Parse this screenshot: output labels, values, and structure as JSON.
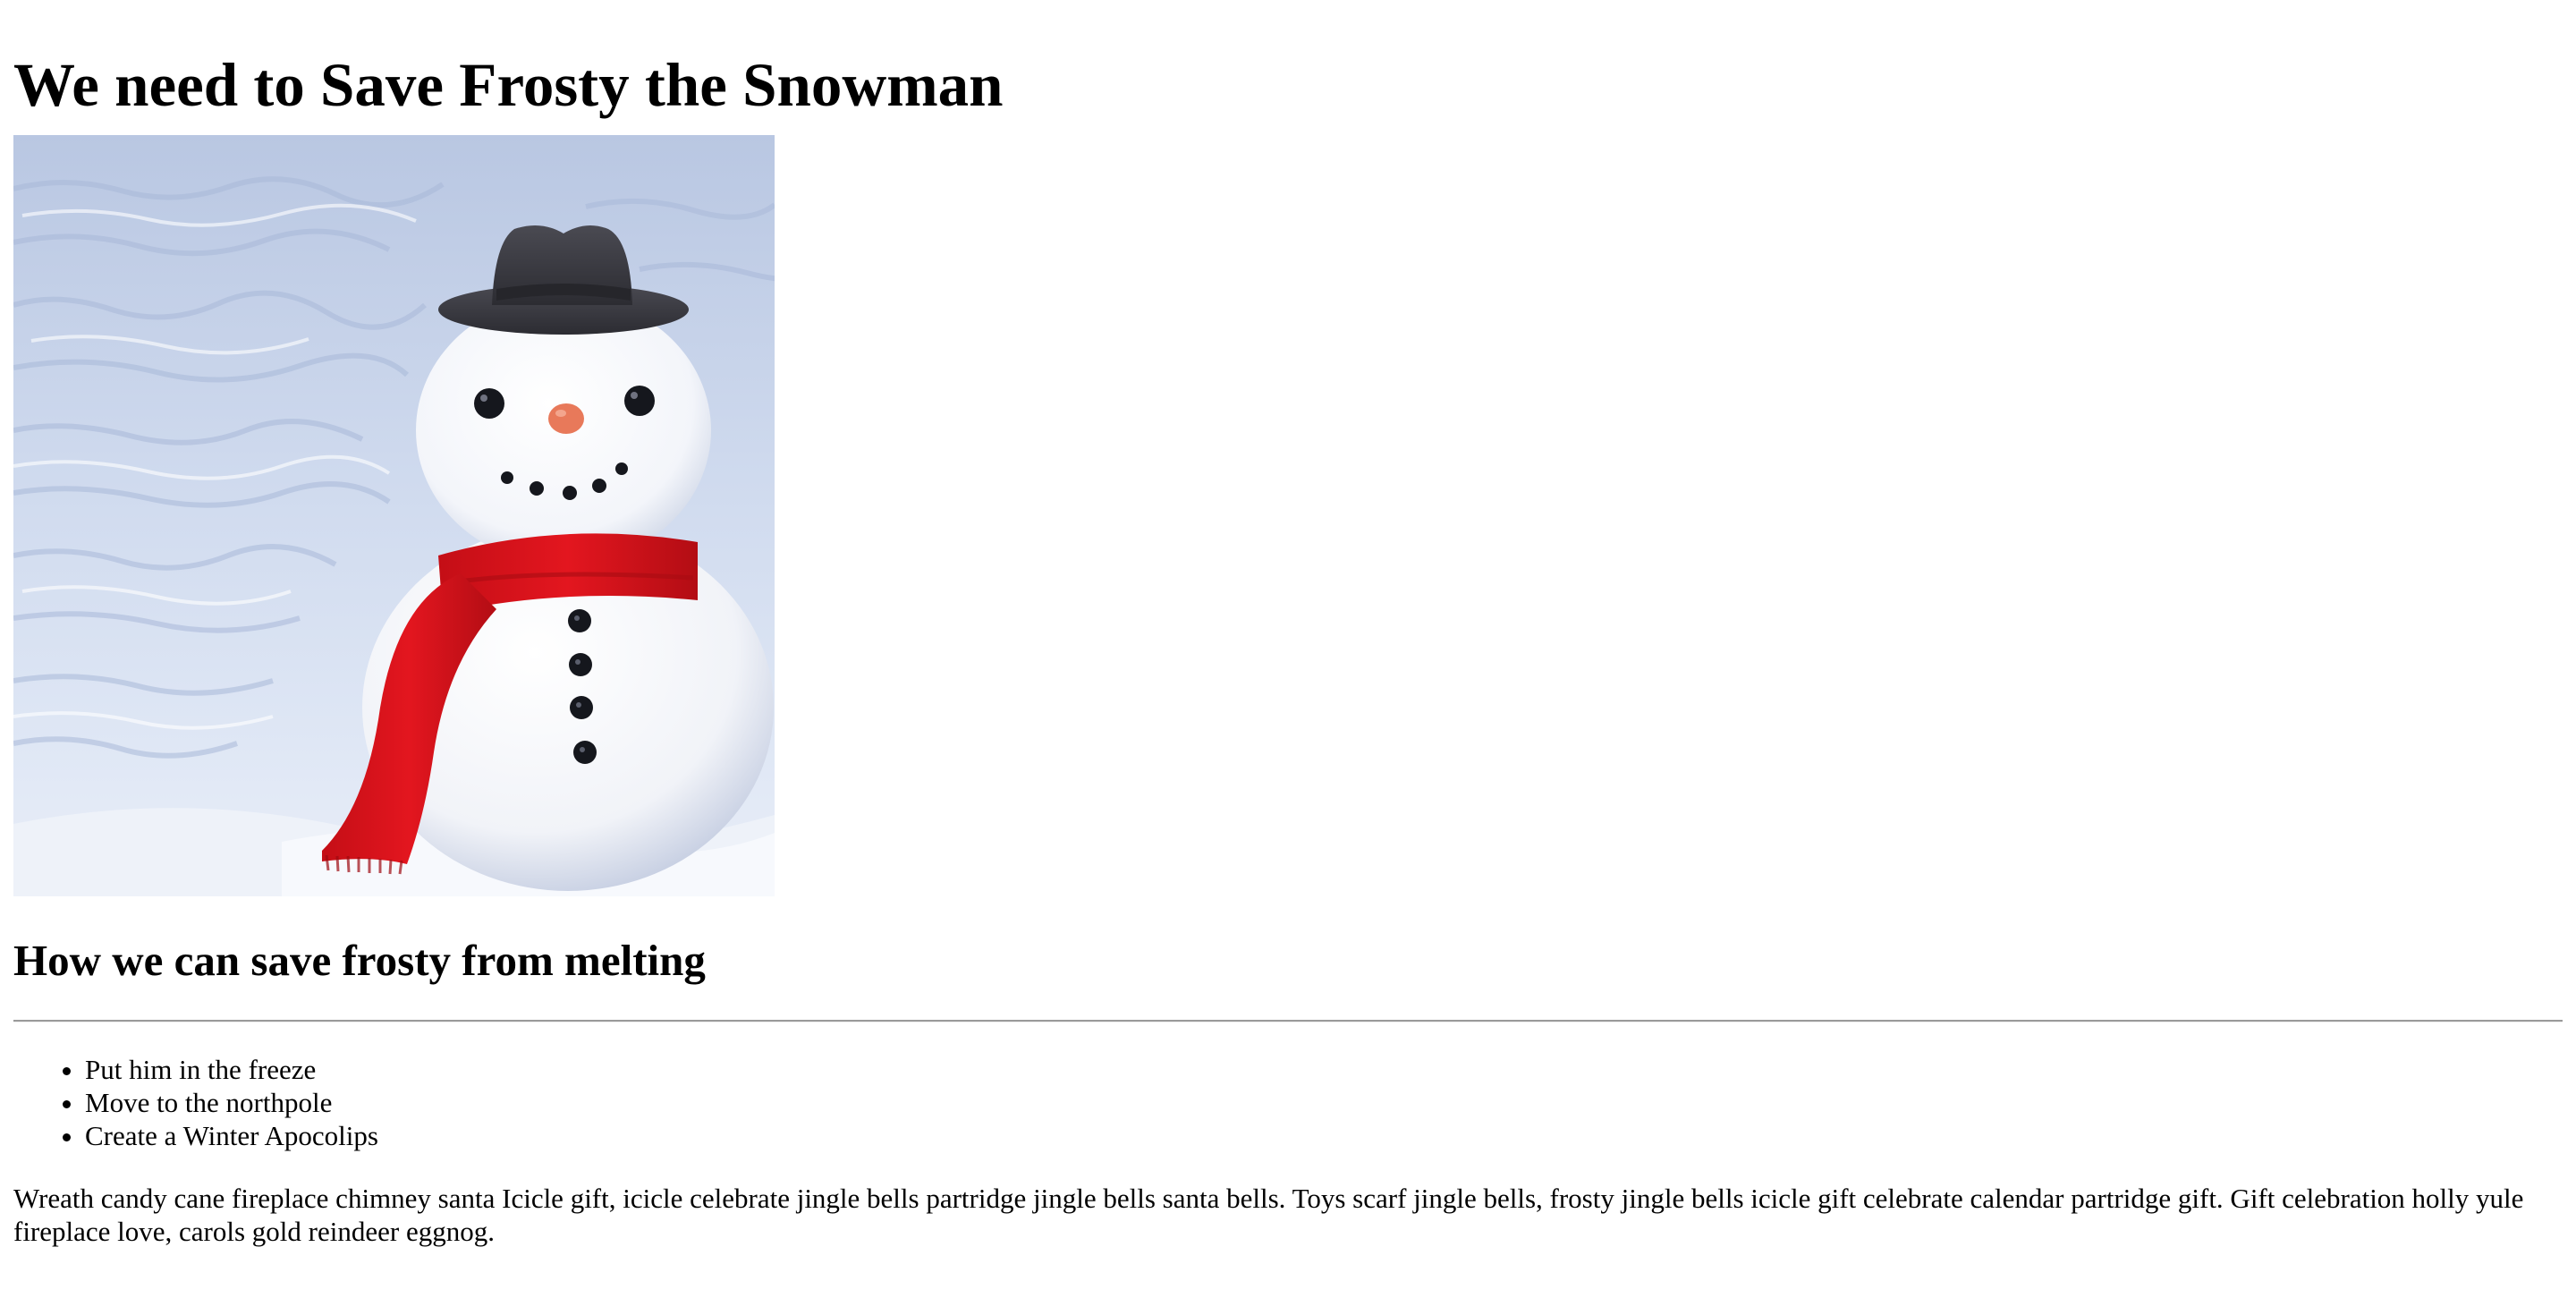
{
  "page": {
    "title": "We need to Save Frosty the Snowman",
    "image": {
      "description": "Snowman with black hat and red scarf in snow",
      "colors": {
        "sky_snow": "#c9d6ec",
        "hat": "#3a3a40",
        "scarf": "#d4121b",
        "nose": "#e8795a",
        "buttons": "#15171d"
      }
    },
    "subtitle": "How we can save frosty from melting",
    "list": [
      "Put him in the freeze",
      "Move to the northpole",
      "Create a Winter Apocolips"
    ],
    "paragraph": "Wreath candy cane fireplace chimney santa Icicle gift, icicle celebrate jingle bells partridge jingle bells santa bells. Toys scarf jingle bells, frosty jingle bells icicle gift celebrate calendar partridge gift. Gift celebration holly yule fireplace love, carols gold reindeer eggnog."
  }
}
